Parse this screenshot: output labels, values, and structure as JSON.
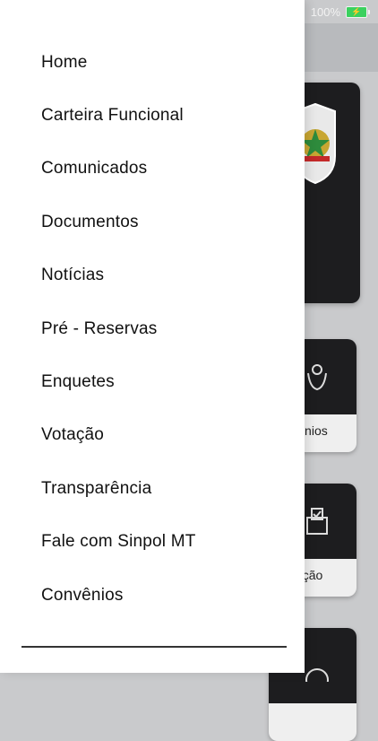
{
  "status_bar": {
    "battery_text": "100%"
  },
  "menu": {
    "items": [
      {
        "label": "Home"
      },
      {
        "label": "Carteira Funcional"
      },
      {
        "label": "Comunicados"
      },
      {
        "label": "Documentos"
      },
      {
        "label": "Notícias"
      },
      {
        "label": "Pré - Reservas"
      },
      {
        "label": "Enquetes"
      },
      {
        "label": "Votação"
      },
      {
        "label": "Transparência"
      },
      {
        "label": "Fale com Sinpol MT"
      },
      {
        "label": "Convênios"
      }
    ]
  },
  "background": {
    "tiles": [
      {
        "label": "ênios"
      },
      {
        "label": "ção"
      }
    ]
  },
  "colors": {
    "battery": "#3bd15f",
    "card_dark": "#1d1d1f",
    "overlay": "#c9cacc"
  }
}
